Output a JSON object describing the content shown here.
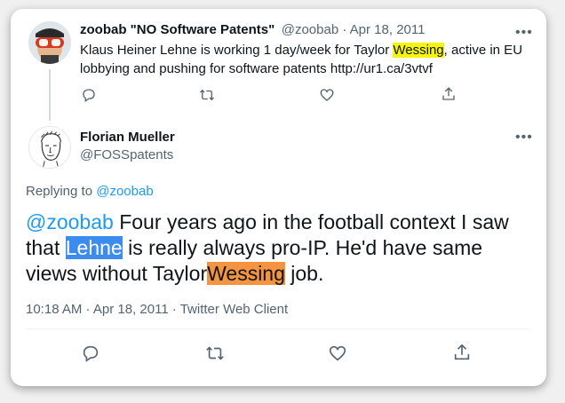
{
  "parent_tweet": {
    "display_name": "zoobab \"NO Software Patents\"",
    "handle_date": "@zoobab · Apr 18, 2011",
    "text_part1": "Klaus Heiner Lehne is working 1 day/week for Taylor ",
    "text_highlight": "Wessing",
    "text_part2": ", active in EU lobbying and pushing for software patents http://ur1.ca/3vtvf"
  },
  "main_tweet": {
    "display_name": "Florian Mueller",
    "handle": "@FOSSpatents",
    "replying_label": "Replying to",
    "replying_handle": "@zoobab",
    "mention": "@zoobab",
    "text_part1": " Four years ago in the football context I saw that ",
    "text_highlight1": "Lehne",
    "text_part2": " is really always pro-IP. He'd have same views without Taylor",
    "text_highlight2": "Wessing",
    "text_part3": " job.",
    "meta": "10:18 AM · Apr 18, 2011 · Twitter Web Client"
  },
  "icons": {
    "more": "more-dots-icon",
    "reply": "reply-icon",
    "retweet": "retweet-icon",
    "like": "like-icon",
    "share": "share-icon"
  },
  "colors": {
    "accent": "#1d9bf0",
    "muted": "#536471",
    "highlight_yellow": "#f5f50a",
    "highlight_blue": "#3c8cf0",
    "highlight_orange": "#f59440"
  }
}
